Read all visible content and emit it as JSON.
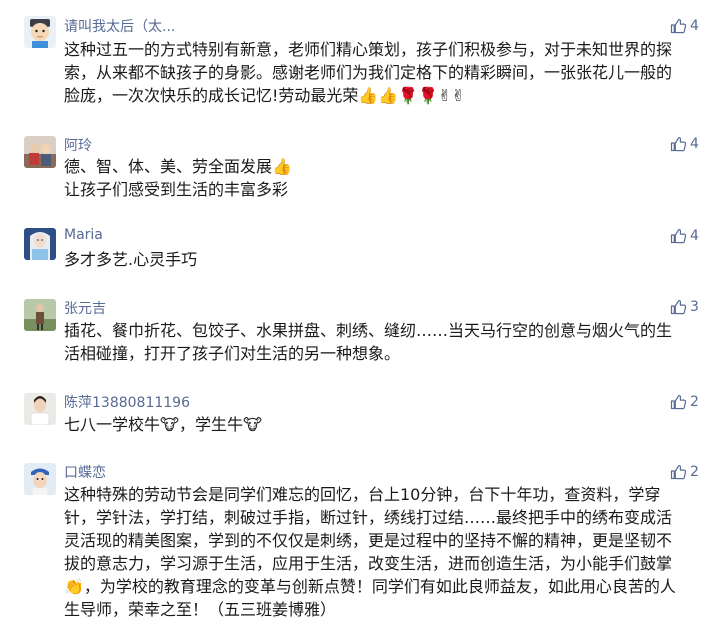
{
  "comments": [
    {
      "name": "请叫我太后（太...",
      "likes": "4",
      "avatar": "cartoon-face-avatar",
      "lines": [
        "这种过五一的方式特别有新意，老师们精心策划，孩子们积极参与，对于未知世界的探",
        "索，从来都不缺孩子的身影。感谢老师们为我们定格下的精彩瞬间，一张张花儿一般的",
        "脸庞，一次次快乐的成长记忆!劳动最光荣👍👍🌹🌹✌✌"
      ]
    },
    {
      "name": "阿玲",
      "likes": "4",
      "avatar": "photo-avatar",
      "lines": [
        "德、智、体、美、劳全面发展👍",
        "让孩子们感受到生活的丰富多彩"
      ]
    },
    {
      "name": "Maria",
      "likes": "4",
      "avatar": "ice-princess-avatar",
      "lines": [
        "多才多艺.心灵手巧"
      ]
    },
    {
      "name": "张元吉",
      "likes": "3",
      "avatar": "outdoor-photo-avatar",
      "lines": [
        "插花、餐巾折花、包饺子、水果拼盘、刺绣、缝纫……当天马行空的创意与烟火气的生",
        "活相碰撞，打开了孩子们对生活的另一种想象。"
      ]
    },
    {
      "name": "陈萍13880811196",
      "likes": "2",
      "avatar": "portrait-avatar",
      "lines": [
        "七八一学校牛🐮，学生牛🐮"
      ]
    },
    {
      "name": "口蝶恋",
      "likes": "2",
      "avatar": "child-photo-avatar",
      "lines": [
        "这种特殊的劳动节会是同学们难忘的回忆，台上10分钟，台下十年功，查资料，学穿",
        "针，学针法，学打结，刺破过手指，断过针，绣线打过结……最终把手中的绣布变成活",
        "灵活现的精美图案，学到的不仅仅是刺绣，更是过程中的坚持不懈的精神，更是坚韧不",
        "拔的意志力，学习源于生活，应用于生活，改变生活，进而创造生活，为小能手们鼓掌",
        "👏，为学校的教育理念的变革与创新点赞！同学们有如此良师益友，如此用心良苦的人",
        "生导师，荣幸之至！（五三班姜博雅）"
      ]
    }
  ]
}
